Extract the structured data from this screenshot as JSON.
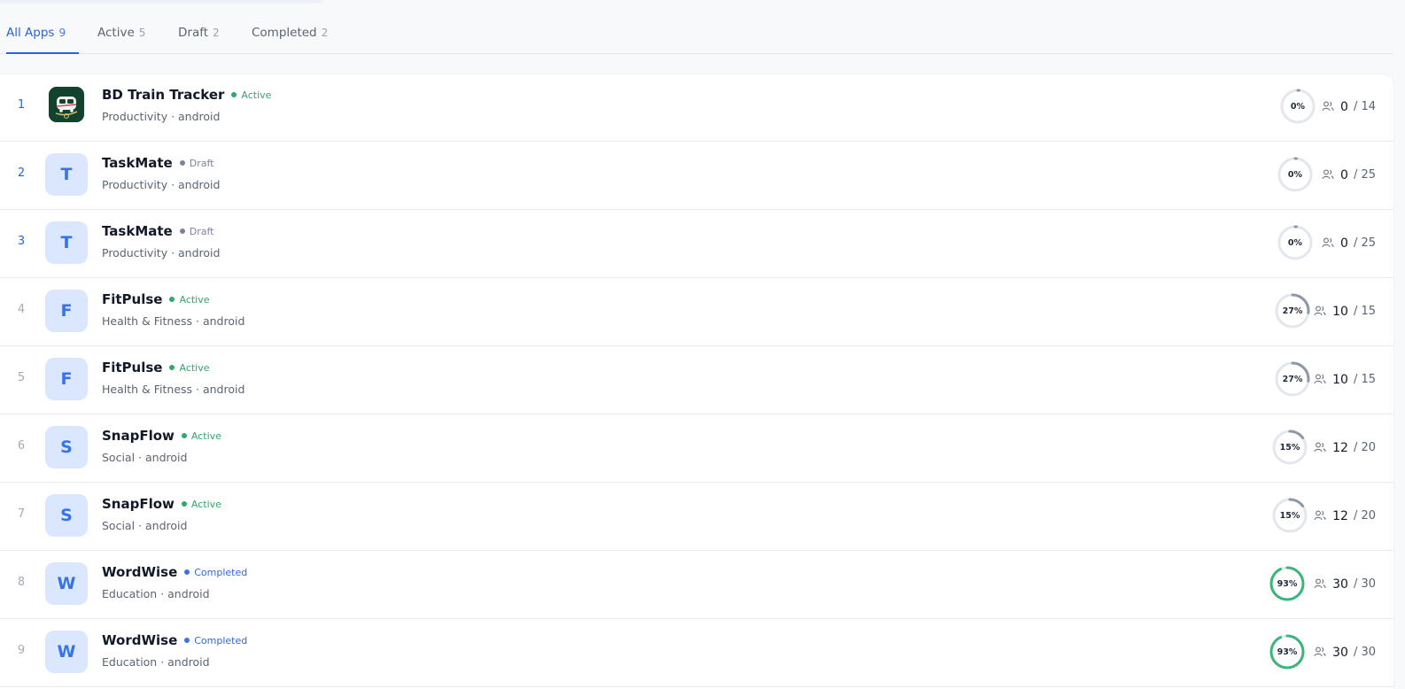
{
  "tabs": [
    {
      "label": "All Apps",
      "count": "9",
      "active": true
    },
    {
      "label": "Active",
      "count": "5",
      "active": false
    },
    {
      "label": "Draft",
      "count": "2",
      "active": false
    },
    {
      "label": "Completed",
      "count": "2",
      "active": false
    }
  ],
  "colors": {
    "accent": "#2b63dd",
    "active_status": "#2fa86b",
    "draft_status": "#7b8594",
    "completed_status": "#3168dd",
    "ring_progress_gray": "#8e97a6",
    "ring_progress_green": "#3cb57a",
    "ring_track": "#e3e7ed",
    "icon_background": "#dbe7fe"
  },
  "apps": [
    {
      "rank": "1",
      "name": "BD Train Tracker",
      "status": "Active",
      "status_key": "active",
      "category": "Productivity",
      "platform": "android",
      "meta": "Productivity · android",
      "icon": "train-app-logo",
      "icon_letter": "",
      "progress": 0,
      "progress_label": "0%",
      "users_current": "0",
      "users_total": "/ 14"
    },
    {
      "rank": "2",
      "name": "TaskMate",
      "status": "Draft",
      "status_key": "draft",
      "category": "Productivity",
      "platform": "android",
      "meta": "Productivity · android",
      "icon": "letter-avatar",
      "icon_letter": "T",
      "progress": 0,
      "progress_label": "0%",
      "users_current": "0",
      "users_total": "/ 25"
    },
    {
      "rank": "3",
      "name": "TaskMate",
      "status": "Draft",
      "status_key": "draft",
      "category": "Productivity",
      "platform": "android",
      "meta": "Productivity · android",
      "icon": "letter-avatar",
      "icon_letter": "T",
      "progress": 0,
      "progress_label": "0%",
      "users_current": "0",
      "users_total": "/ 25"
    },
    {
      "rank": "4",
      "name": "FitPulse",
      "status": "Active",
      "status_key": "active",
      "category": "Health & Fitness",
      "platform": "android",
      "meta": "Health & Fitness · android",
      "icon": "letter-avatar",
      "icon_letter": "F",
      "progress": 27,
      "progress_label": "27%",
      "users_current": "10",
      "users_total": "/ 15"
    },
    {
      "rank": "5",
      "name": "FitPulse",
      "status": "Active",
      "status_key": "active",
      "category": "Health & Fitness",
      "platform": "android",
      "meta": "Health & Fitness · android",
      "icon": "letter-avatar",
      "icon_letter": "F",
      "progress": 27,
      "progress_label": "27%",
      "users_current": "10",
      "users_total": "/ 15"
    },
    {
      "rank": "6",
      "name": "SnapFlow",
      "status": "Active",
      "status_key": "active",
      "category": "Social",
      "platform": "android",
      "meta": "Social · android",
      "icon": "letter-avatar",
      "icon_letter": "S",
      "progress": 15,
      "progress_label": "15%",
      "users_current": "12",
      "users_total": "/ 20"
    },
    {
      "rank": "7",
      "name": "SnapFlow",
      "status": "Active",
      "status_key": "active",
      "category": "Social",
      "platform": "android",
      "meta": "Social · android",
      "icon": "letter-avatar",
      "icon_letter": "S",
      "progress": 15,
      "progress_label": "15%",
      "users_current": "12",
      "users_total": "/ 20"
    },
    {
      "rank": "8",
      "name": "WordWise",
      "status": "Completed",
      "status_key": "completed",
      "category": "Education",
      "platform": "android",
      "meta": "Education · android",
      "icon": "letter-avatar",
      "icon_letter": "W",
      "progress": 93,
      "progress_label": "93%",
      "users_current": "30",
      "users_total": "/ 30"
    },
    {
      "rank": "9",
      "name": "WordWise",
      "status": "Completed",
      "status_key": "completed",
      "category": "Education",
      "platform": "android",
      "meta": "Education · android",
      "icon": "letter-avatar",
      "icon_letter": "W",
      "progress": 93,
      "progress_label": "93%",
      "users_current": "30",
      "users_total": "/ 30"
    }
  ]
}
